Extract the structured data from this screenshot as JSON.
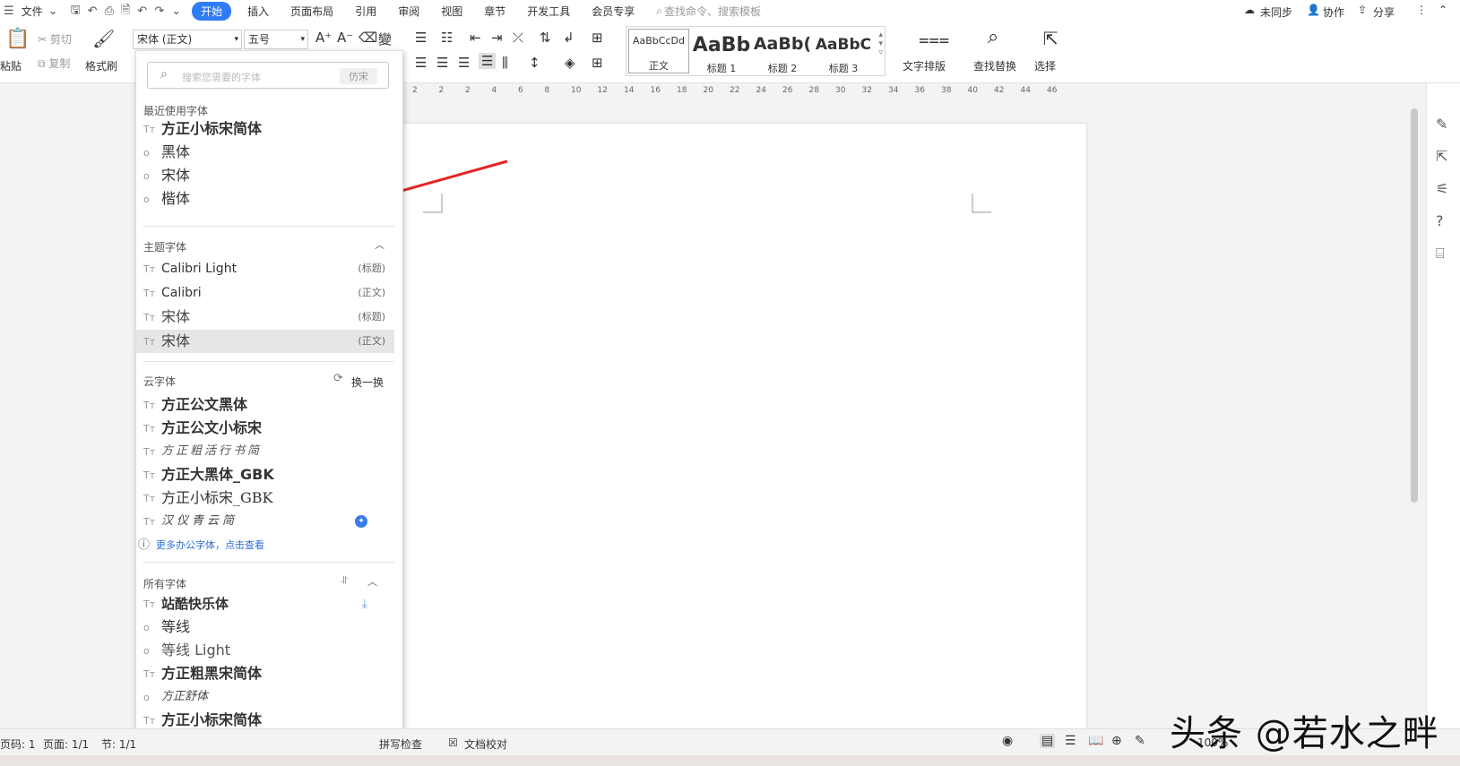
{
  "menubar": {
    "file": "文件",
    "tab_start": "开始",
    "tab_insert": "插入",
    "tab_layout": "页面布局",
    "tab_ref": "引用",
    "tab_review": "审阅",
    "tab_view": "视图",
    "tab_chapter": "章节",
    "tab_dev": "开发工具",
    "tab_member": "会员专享",
    "search_placeholder": "查找命令、搜索模板",
    "sync": "未同步",
    "collab": "协作",
    "share": "分享"
  },
  "ribbon": {
    "paste": "粘贴",
    "cut": "剪切",
    "copy": "复制",
    "format_painter": "格式刷",
    "font_name": "宋体 (正文)",
    "font_size": "五号",
    "styles": [
      {
        "preview": "AaBbCcDd",
        "label": "正文"
      },
      {
        "preview": "AaBb",
        "label": "标题 1"
      },
      {
        "preview": "AaBb(",
        "label": "标题 2"
      },
      {
        "preview": "AaBbC",
        "label": "标题 3"
      }
    ],
    "text_layout": "文字排版",
    "find_replace": "查找替换",
    "select": "选择"
  },
  "ruler_ticks": [
    "2",
    "2",
    "2",
    "4",
    "6",
    "8",
    "10",
    "12",
    "14",
    "16",
    "18",
    "20",
    "22",
    "24",
    "26",
    "28",
    "30",
    "32",
    "34",
    "36",
    "38",
    "40",
    "42",
    "44",
    "46"
  ],
  "dropdown": {
    "search_placeholder": "搜索您需要的字体",
    "search_tag": "仿宋",
    "recent_title": "最近使用字体",
    "recent": [
      "方正小标宋简体",
      "黑体",
      "宋体",
      "楷体"
    ],
    "theme_title": "主题字体",
    "theme": [
      {
        "name": "Calibri Light",
        "tag": "(标题)"
      },
      {
        "name": "Calibri",
        "tag": "(正文)"
      },
      {
        "name": "宋体",
        "tag": "(标题)"
      },
      {
        "name": "宋体",
        "tag": "(正文)"
      }
    ],
    "cloud_title": "云字体",
    "cloud_refresh": "换一换",
    "cloud": [
      "方正公文黑体",
      "方正公文小标宋",
      "方正粗活行书简",
      "方正大黑体_GBK",
      "方正小标宋_GBK",
      "汉仪青云简"
    ],
    "more_link": "更多办公字体，点击查看",
    "all_title": "所有字体",
    "all": [
      "站酷快乐体",
      "等线",
      "等线 Light",
      "方正粗黑宋简体",
      "方正舒体",
      "方正小标宋简体"
    ]
  },
  "status": {
    "page_code": "页码: 1",
    "page": "页面: 1/1",
    "section": "节: 1/1",
    "spell": "拼写检查",
    "doc_check": "文档校对",
    "zoom": "100%"
  },
  "watermark": "头条 @若水之畔"
}
